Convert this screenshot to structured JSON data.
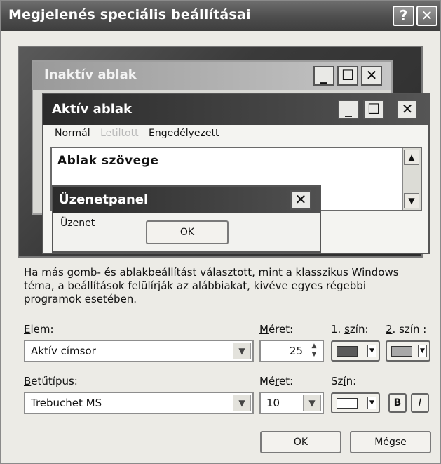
{
  "dialog": {
    "title": "Megjelenés speciális beállításai",
    "help_label": "?",
    "close_label": "✕"
  },
  "preview": {
    "inactive_window_title": "Inaktív ablak",
    "active_window_title": "Aktív ablak",
    "min_label": "_",
    "max_label": "☐",
    "close_label": "✕",
    "menu": {
      "normal": "Normál",
      "disabled": "Letiltott",
      "selected": "Engedélyezett"
    },
    "window_text": "Ablak szövege",
    "message_panel_title": "Üzenetpanel",
    "message_text": "Üzenet",
    "ok_label": "OK"
  },
  "description": "Ha más gomb- és ablakbeállítást választott, mint a klasszikus Windows téma, a beállítások felülírják az alábbiakat, kivéve egyes régebbi programok esetében.",
  "item": {
    "label_prefix": "",
    "label_ul": "E",
    "label_rest": "lem:",
    "value": "Aktív címsor"
  },
  "item_size": {
    "label_ul": "M",
    "label_rest": "éret:",
    "value": "25"
  },
  "color1": {
    "label_pre": "1. ",
    "label_ul": "s",
    "label_rest": "zín:",
    "swatch": "#5a5a5a"
  },
  "color2": {
    "label_ul": "2",
    "label_rest": ". szín :",
    "swatch": "#a8a8a8"
  },
  "font": {
    "label_ul": "B",
    "label_rest": "etűtípus:",
    "value": "Trebuchet MS"
  },
  "font_size": {
    "label_pre": "Mé",
    "label_ul": "r",
    "label_rest": "et:",
    "value": "10"
  },
  "font_color": {
    "label_pre": "Sz",
    "label_ul": "í",
    "label_rest": "n:",
    "swatch": "#ffffff"
  },
  "bold_label": "B",
  "italic_label": "I",
  "buttons": {
    "ok": "OK",
    "cancel": "Mégse"
  },
  "icons": {
    "dropdown": "chevron-down-icon",
    "spin": "spinner-icon"
  }
}
